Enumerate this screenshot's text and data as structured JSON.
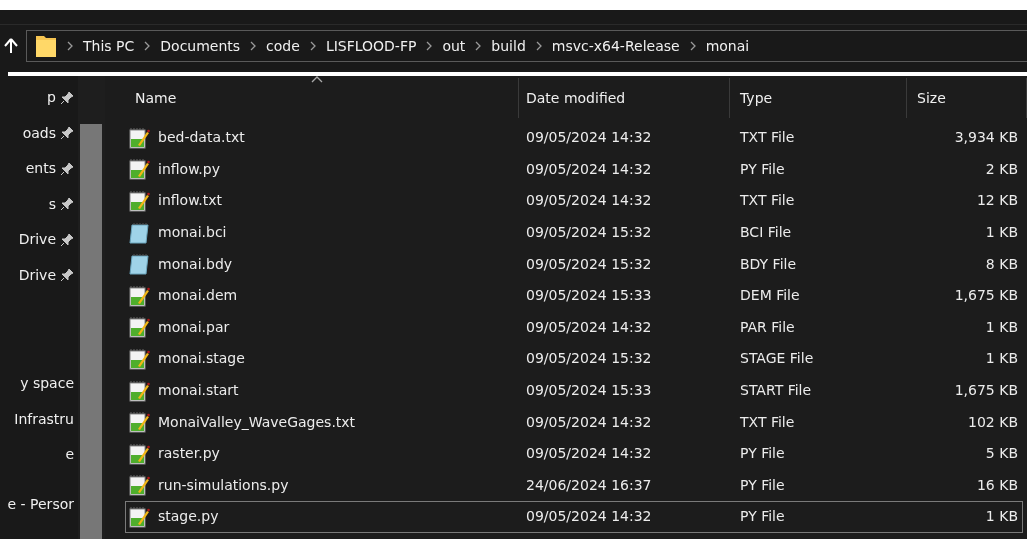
{
  "address_bar": {
    "crumbs": [
      "This PC",
      "Documents",
      "code",
      "LISFLOOD-FP",
      "out",
      "build",
      "msvc-x64-Release",
      "monai"
    ]
  },
  "sidebar": {
    "items": [
      {
        "label": "p",
        "pinned": true
      },
      {
        "label": "oads",
        "pinned": true
      },
      {
        "label": "ents",
        "pinned": true
      },
      {
        "label": "s",
        "pinned": true
      },
      {
        "label": "Drive",
        "pinned": true
      },
      {
        "label": "Drive",
        "pinned": true
      },
      {
        "label": "y space",
        "pinned": false
      },
      {
        "label": "Infrastru",
        "pinned": false
      },
      {
        "label": "e",
        "pinned": false
      },
      {
        "label": "e - Persor",
        "pinned": false
      }
    ]
  },
  "table": {
    "columns": [
      "Name",
      "Date modified",
      "Type",
      "Size"
    ],
    "rows": [
      {
        "name": "bed-data.txt",
        "date": "09/05/2024 14:32",
        "type": "TXT File",
        "size": "3,934 KB",
        "kind": "notepadpp",
        "selected": false
      },
      {
        "name": "inflow.py",
        "date": "09/05/2024 14:32",
        "type": "PY File",
        "size": "2 KB",
        "kind": "notepadpp",
        "selected": false
      },
      {
        "name": "inflow.txt",
        "date": "09/05/2024 14:32",
        "type": "TXT File",
        "size": "12 KB",
        "kind": "notepadpp",
        "selected": false
      },
      {
        "name": "monai.bci",
        "date": "09/05/2024 15:32",
        "type": "BCI File",
        "size": "1 KB",
        "kind": "notepad",
        "selected": false
      },
      {
        "name": "monai.bdy",
        "date": "09/05/2024 15:32",
        "type": "BDY File",
        "size": "8 KB",
        "kind": "notepad",
        "selected": false
      },
      {
        "name": "monai.dem",
        "date": "09/05/2024 15:33",
        "type": "DEM File",
        "size": "1,675 KB",
        "kind": "notepadpp",
        "selected": false
      },
      {
        "name": "monai.par",
        "date": "09/05/2024 14:32",
        "type": "PAR File",
        "size": "1 KB",
        "kind": "notepadpp",
        "selected": false
      },
      {
        "name": "monai.stage",
        "date": "09/05/2024 15:32",
        "type": "STAGE File",
        "size": "1 KB",
        "kind": "notepadpp",
        "selected": false
      },
      {
        "name": "monai.start",
        "date": "09/05/2024 15:33",
        "type": "START File",
        "size": "1,675 KB",
        "kind": "notepadpp",
        "selected": false
      },
      {
        "name": "MonaiValley_WaveGages.txt",
        "date": "09/05/2024 14:32",
        "type": "TXT File",
        "size": "102 KB",
        "kind": "notepadpp",
        "selected": false
      },
      {
        "name": "raster.py",
        "date": "09/05/2024 14:32",
        "type": "PY File",
        "size": "5 KB",
        "kind": "notepadpp",
        "selected": false
      },
      {
        "name": "run-simulations.py",
        "date": "24/06/2024 16:37",
        "type": "PY File",
        "size": "16 KB",
        "kind": "notepadpp",
        "selected": false
      },
      {
        "name": "stage.py",
        "date": "09/05/2024 14:32",
        "type": "PY File",
        "size": "1 KB",
        "kind": "notepadpp",
        "selected": true
      }
    ]
  }
}
